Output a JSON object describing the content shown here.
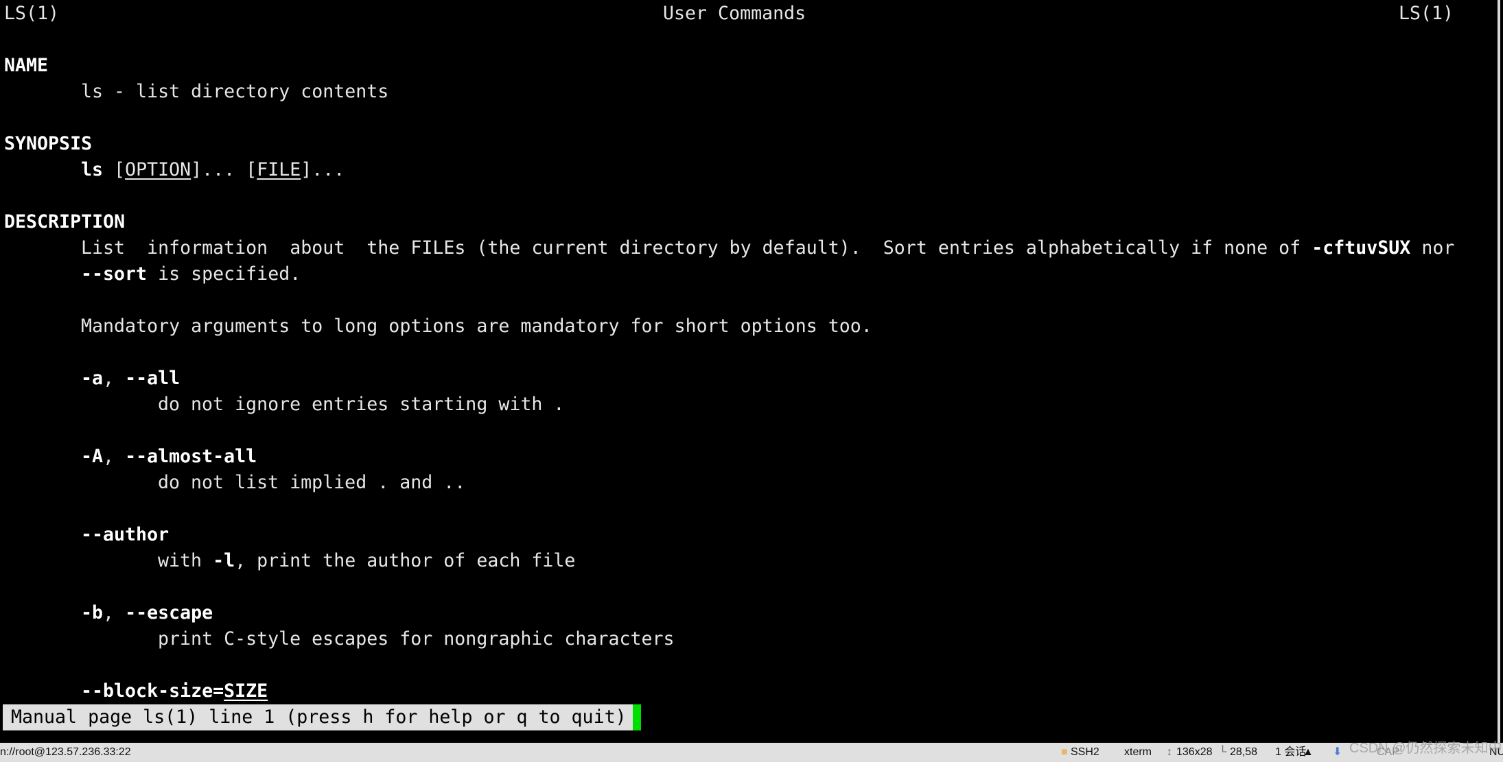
{
  "colors": {
    "background": "#000000",
    "text": "#e6e6e6",
    "status_bg": "#e0e0e0",
    "cursor": "#00e000"
  },
  "header": {
    "left": "LS(1)",
    "center": "User Commands",
    "right": "LS(1)"
  },
  "name": {
    "heading": "NAME",
    "text": "ls - list directory contents"
  },
  "synopsis": {
    "heading": "SYNOPSIS",
    "cmd": "ls",
    "p1": " [",
    "option": "OPTION",
    "p2": "]... [",
    "file": "FILE",
    "p3": "]..."
  },
  "description": {
    "heading": "DESCRIPTION",
    "line1": "List  information  about  the FILEs (the current directory by default).  Sort entries alphabetically if none of ",
    "line1_opt": "-cftuvSUX",
    "line1_end": " nor",
    "line2_opt": "--sort",
    "line2_end": " is specified.",
    "mandatory": "Mandatory arguments to long options are mandatory for short options too."
  },
  "options": [
    {
      "short": "-a",
      "sep": ", ",
      "long": "--all",
      "desc": "do not ignore entries starting with ."
    },
    {
      "short": "-A",
      "sep": ", ",
      "long": "--almost-all",
      "desc": "do not list implied . and .."
    },
    {
      "long": "--author",
      "desc_pre": "with ",
      "desc_opt": "-l",
      "desc_post": ", print the author of each file"
    },
    {
      "short": "-b",
      "sep": ", ",
      "long": "--escape",
      "desc": "print C-style escapes for nongraphic characters"
    },
    {
      "long": "--block-size=",
      "arg": "SIZE"
    }
  ],
  "pager_status": "Manual page ls(1) line 1 (press h for help or q to quit)",
  "statusbar": {
    "connection": "n://root@123.57.236.33:22",
    "protocol": "SSH2",
    "protocol_icon": "lock-icon",
    "terminal": "xterm",
    "size": "136x28",
    "size_icon": "resize-icon",
    "cursor_pos": "28,58",
    "cursor_icon": "cursor-position-icon",
    "sessions": "1 会话",
    "caps": "CAP",
    "num": "NU",
    "watermark": "CSDN @仍然探索未知中"
  }
}
